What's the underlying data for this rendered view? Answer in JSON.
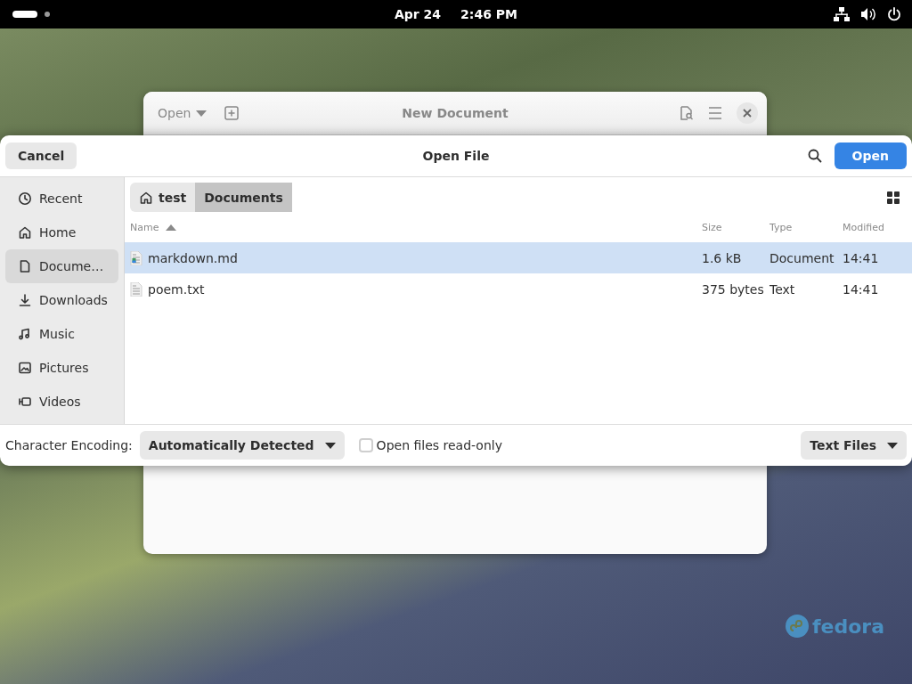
{
  "top_bar": {
    "date": "Apr 24",
    "time": "2:46 PM"
  },
  "background_window": {
    "open_button": "Open",
    "title": "New Document"
  },
  "dialog": {
    "cancel": "Cancel",
    "title": "Open File",
    "open": "Open",
    "sidebar": [
      {
        "label": "Recent",
        "kind": "recent",
        "selected": false
      },
      {
        "label": "Home",
        "kind": "home",
        "selected": false
      },
      {
        "label": "Docume…",
        "kind": "documents",
        "selected": true
      },
      {
        "label": "Downloads",
        "kind": "downloads",
        "selected": false
      },
      {
        "label": "Music",
        "kind": "music",
        "selected": false
      },
      {
        "label": "Pictures",
        "kind": "pictures",
        "selected": false
      },
      {
        "label": "Videos",
        "kind": "videos",
        "selected": false
      }
    ],
    "path": [
      {
        "label": "test",
        "kind": "home",
        "selected": false
      },
      {
        "label": "Documents",
        "kind": "folder",
        "selected": true
      }
    ],
    "columns": [
      "Name",
      "Size",
      "Type",
      "Modified"
    ],
    "rows": [
      {
        "name": "markdown.md",
        "kind": "markdown",
        "size": "1.6 kB",
        "type": "Document",
        "modified": "14:41",
        "selected": true
      },
      {
        "name": "poem.txt",
        "kind": "plain",
        "size": "375 bytes",
        "type": "Text",
        "modified": "14:41",
        "selected": false
      }
    ],
    "encoding_label": "Character Encoding:",
    "encoding": "Automatically Detected",
    "read_only": {
      "label": "Open files read-only",
      "checked": false
    },
    "filter": "Text Files"
  },
  "desktop": {
    "logo": "fedora"
  }
}
